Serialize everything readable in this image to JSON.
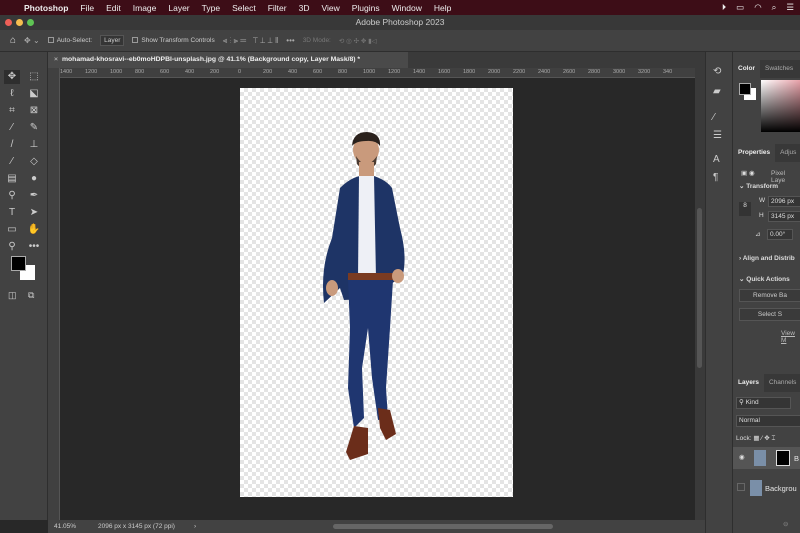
{
  "menubar": {
    "app": "Photoshop",
    "items": [
      "File",
      "Edit",
      "Image",
      "Layer",
      "Type",
      "Select",
      "Filter",
      "3D",
      "View",
      "Plugins",
      "Window",
      "Help"
    ]
  },
  "window": {
    "title": "Adobe Photoshop 2023"
  },
  "options": {
    "auto_select": "Auto-Select:",
    "layer_select": "Layer",
    "show_transform": "Show Transform Controls",
    "mode_3d": "3D Mode:"
  },
  "document": {
    "tab_title": "mohamad-khosravi--eb0moHDPBI-unsplash.jpg @ 41.1% (Background copy, Layer Mask/8) *"
  },
  "ruler": {
    "ticks": [
      "1400",
      "1200",
      "1000",
      "800",
      "600",
      "400",
      "200",
      "0",
      "200",
      "400",
      "600",
      "800",
      "1000",
      "1200",
      "1400",
      "1600",
      "1800",
      "2000",
      "2200",
      "2400",
      "2600",
      "2800",
      "3000",
      "3200",
      "340"
    ]
  },
  "status": {
    "zoom": "41.05%",
    "size": "2096 px x 3145 px (72 ppi)"
  },
  "color_panel": {
    "tabs": [
      "Color",
      "Swatches"
    ]
  },
  "properties": {
    "tabs": [
      "Properties",
      "Adjus"
    ],
    "kind": "Pixel Laye",
    "transform": "Transform",
    "w_label": "W",
    "w": "2096 px",
    "h_label": "H",
    "h": "3145 px",
    "angle": "0.00°",
    "align": "Align and Distrib",
    "quick_actions": "Quick Actions",
    "remove_bg": "Remove Ba",
    "select_subject": "Select S",
    "view_more": "View M"
  },
  "layers": {
    "tabs": [
      "Layers",
      "Channels"
    ],
    "kind": "Kind",
    "blend": "Normal",
    "lock": "Lock:",
    "items": [
      {
        "name": "B"
      },
      {
        "name": "Backgrou"
      }
    ]
  }
}
